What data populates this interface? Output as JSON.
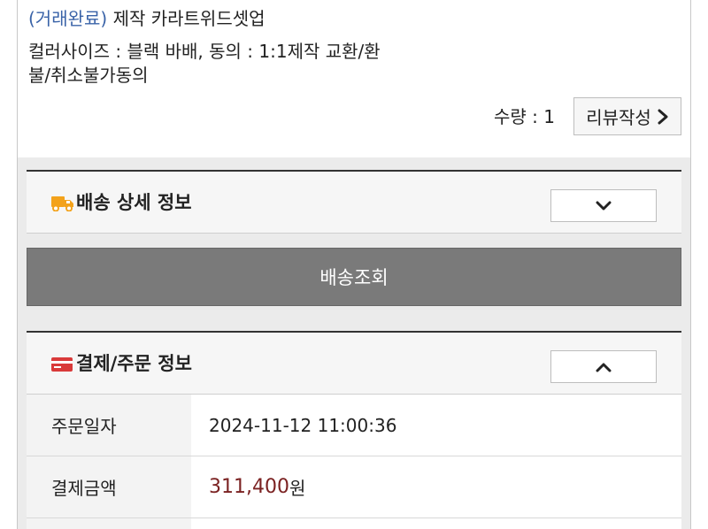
{
  "product": {
    "status": "(거래완료)",
    "name": "제작 카라트위드셋업",
    "options_line1": "컬러사이즈 : 블랙 바배, 동의 : 1:1제작 교환/환",
    "options_line2": "불/취소불가동의",
    "quantity_text": "수량 : 1",
    "review_label": "리뷰작성"
  },
  "shipping": {
    "title": "배송 상세 정보",
    "track_label": "배송조회"
  },
  "payment": {
    "title": "결제/주문 정보",
    "rows": [
      {
        "label": "주문일자",
        "value": "2024-11-12 11:00:36"
      },
      {
        "label": "결제금액",
        "amount": "311,400",
        "unit": "원"
      }
    ]
  },
  "colors": {
    "status": "#3a63a8",
    "amount": "#7b2222",
    "truck_icon": "#f3a21b",
    "card_icon": "#d93a3a"
  },
  "icons": {
    "review_chevron": "chevron-right-icon",
    "shipping_toggle": "chevron-down-icon",
    "payment_toggle": "chevron-up-icon",
    "shipping": "truck-icon",
    "payment": "credit-card-icon"
  }
}
